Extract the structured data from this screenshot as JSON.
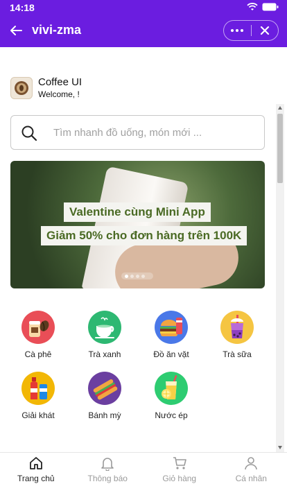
{
  "status_bar": {
    "time": "14:18"
  },
  "app_bar": {
    "title": "vivi-zma"
  },
  "profile": {
    "name": "Coffee UI",
    "welcome": "Welcome, !"
  },
  "search": {
    "placeholder": "Tìm nhanh đồ uống, món mới ..."
  },
  "banner": {
    "line1": "Valentine cùng Mini App",
    "line2": "Giảm 50% cho đơn hàng trên 100K",
    "slide_count": 4,
    "active_slide": 1
  },
  "categories": [
    {
      "label": "Cà phê",
      "icon": "coffee-icon",
      "color": "#e94e57"
    },
    {
      "label": "Trà xanh",
      "icon": "green-tea-icon",
      "color": "#2eb872"
    },
    {
      "label": "Đồ ăn vặt",
      "icon": "burger-icon",
      "color": "#4a78e8"
    },
    {
      "label": "Trà sữa",
      "icon": "milk-tea-icon",
      "color": "#f5c542"
    },
    {
      "label": "Giải khát",
      "icon": "soft-drink-icon",
      "color": "#f2b705"
    },
    {
      "label": "Bánh mỳ",
      "icon": "sandwich-icon",
      "color": "#6b3fa0"
    },
    {
      "label": "Nước ép",
      "icon": "juice-icon",
      "color": "#2ecc71"
    }
  ],
  "tabs": [
    {
      "label": "Trang chủ",
      "icon": "home-icon",
      "active": true
    },
    {
      "label": "Thông báo",
      "icon": "bell-icon",
      "active": false
    },
    {
      "label": "Giỏ hàng",
      "icon": "cart-icon",
      "active": false
    },
    {
      "label": "Cá nhân",
      "icon": "user-icon",
      "active": false
    }
  ],
  "colors": {
    "brand": "#6b1de0",
    "banner_text": "#4a6a24"
  }
}
